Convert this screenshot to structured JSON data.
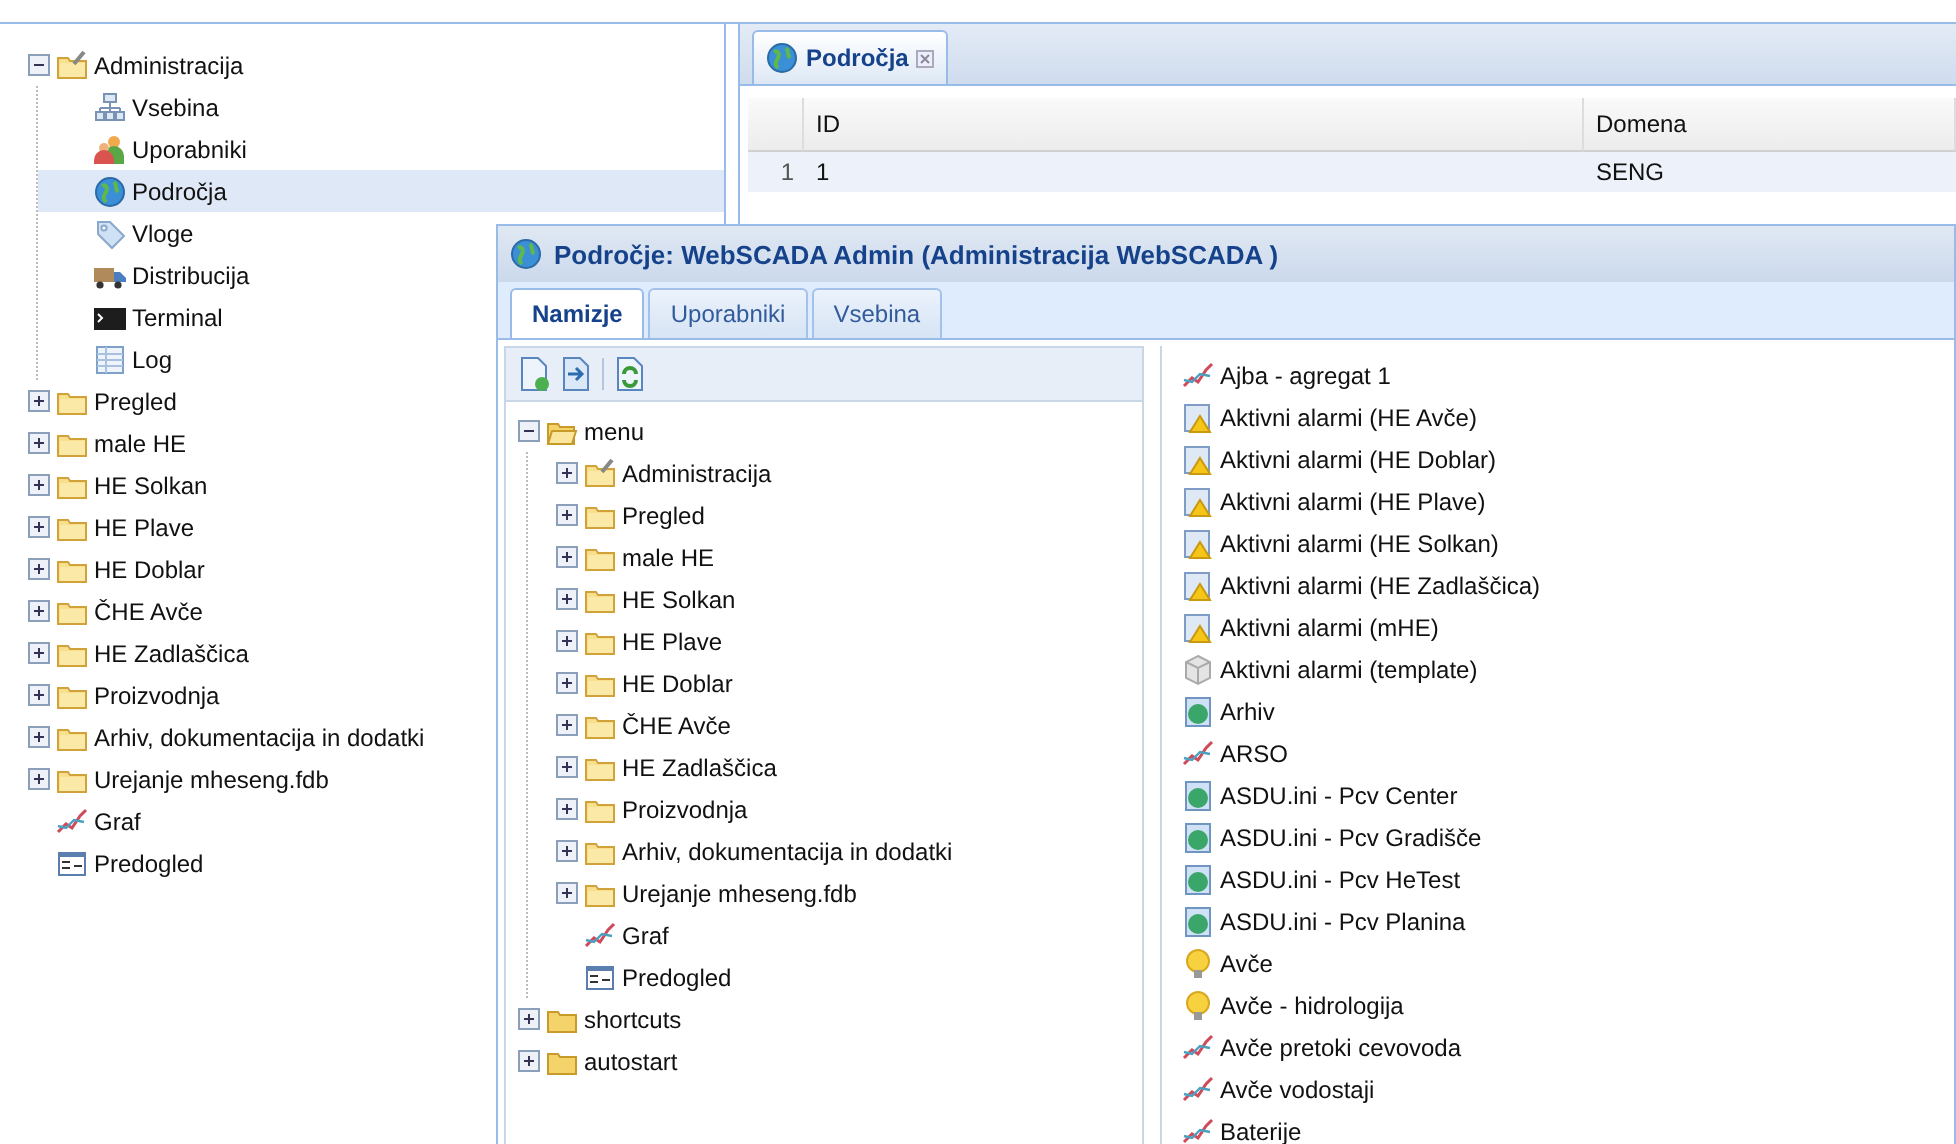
{
  "navigation_tree": {
    "items": [
      {
        "label": "Administracija",
        "kind": "admin",
        "expanded": true,
        "selected": false,
        "children": [
          {
            "label": "Vsebina",
            "kind": "content",
            "selected": false
          },
          {
            "label": "Uporabniki",
            "kind": "users",
            "selected": false
          },
          {
            "label": "Področja",
            "kind": "globe",
            "selected": true
          },
          {
            "label": "Vloge",
            "kind": "tag",
            "selected": false
          },
          {
            "label": "Distribucija",
            "kind": "truck",
            "selected": false
          },
          {
            "label": "Terminal",
            "kind": "terminal",
            "selected": false
          },
          {
            "label": "Log",
            "kind": "table",
            "selected": false
          }
        ]
      },
      {
        "label": "Pregled",
        "kind": "folder",
        "expanded": false,
        "selected": false
      },
      {
        "label": "male HE",
        "kind": "folder",
        "expanded": false,
        "selected": false
      },
      {
        "label": "HE Solkan",
        "kind": "folder",
        "expanded": false,
        "selected": false
      },
      {
        "label": "HE Plave",
        "kind": "folder",
        "expanded": false,
        "selected": false
      },
      {
        "label": "HE Doblar",
        "kind": "folder",
        "expanded": false,
        "selected": false
      },
      {
        "label": "ČHE Avče",
        "kind": "folder",
        "expanded": false,
        "selected": false
      },
      {
        "label": "HE Zadlaščica",
        "kind": "folder",
        "expanded": false,
        "selected": false
      },
      {
        "label": "Proizvodnja",
        "kind": "folder",
        "expanded": false,
        "selected": false
      },
      {
        "label": "Arhiv, dokumentacija in dodatki",
        "kind": "folder",
        "expanded": false,
        "selected": false
      },
      {
        "label": "Urejanje mheseng.fdb",
        "kind": "folder",
        "expanded": false,
        "selected": false
      },
      {
        "label": "Graf",
        "kind": "graph",
        "selected": false
      },
      {
        "label": "Predogled",
        "kind": "preview",
        "selected": false
      }
    ]
  },
  "main_panel": {
    "tab": {
      "label": "Področja",
      "kind": "globe"
    },
    "table": {
      "columns": [
        "ID",
        "Domena"
      ],
      "rows": [
        {
          "number": "1",
          "cells": [
            "1",
            "SENG"
          ]
        }
      ]
    }
  },
  "dialog": {
    "title": "Področje: WebSCADA Admin (Administracija WebSCADA )",
    "tabs": [
      {
        "label": "Namizje",
        "selected": true
      },
      {
        "label": "Uporabniki",
        "selected": false
      },
      {
        "label": "Vsebina",
        "selected": false
      }
    ],
    "toolbar": [
      {
        "kind": "add"
      },
      {
        "kind": "import"
      },
      {
        "kind": "refresh"
      }
    ],
    "menu_tree": {
      "items": [
        {
          "label": "menu",
          "kind": "open",
          "expanded": true,
          "children": [
            {
              "label": "Administracija",
              "kind": "admin",
              "expanded": false
            },
            {
              "label": "Pregled",
              "kind": "folder",
              "expanded": false
            },
            {
              "label": "male HE",
              "kind": "folder",
              "expanded": false
            },
            {
              "label": "HE Solkan",
              "kind": "folder",
              "expanded": false
            },
            {
              "label": "HE Plave",
              "kind": "folder",
              "expanded": false
            },
            {
              "label": "HE Doblar",
              "kind": "folder",
              "expanded": false
            },
            {
              "label": "ČHE Avče",
              "kind": "folder",
              "expanded": false
            },
            {
              "label": "HE Zadlaščica",
              "kind": "folder",
              "expanded": false
            },
            {
              "label": "Proizvodnja",
              "kind": "folder",
              "expanded": false
            },
            {
              "label": "Arhiv, dokumentacija in dodatki",
              "kind": "folder",
              "expanded": false
            },
            {
              "label": "Urejanje mheseng.fdb",
              "kind": "folder",
              "expanded": false
            },
            {
              "label": "Graf",
              "kind": "graph"
            },
            {
              "label": "Predogled",
              "kind": "preview"
            }
          ]
        },
        {
          "label": "shortcuts",
          "kind": "plain",
          "expanded": false
        },
        {
          "label": "autostart",
          "kind": "plain",
          "expanded": false
        }
      ]
    },
    "available_items": [
      {
        "label": "Ajba - agregat 1",
        "kind": "graph"
      },
      {
        "label": "Aktivni alarmi (HE Avče)",
        "kind": "alarm"
      },
      {
        "label": "Aktivni alarmi (HE Doblar)",
        "kind": "alarm"
      },
      {
        "label": "Aktivni alarmi (HE Plave)",
        "kind": "alarm"
      },
      {
        "label": "Aktivni alarmi (HE Solkan)",
        "kind": "alarm"
      },
      {
        "label": "Aktivni alarmi (HE Zadlaščica)",
        "kind": "alarm"
      },
      {
        "label": "Aktivni alarmi (mHE)",
        "kind": "alarm"
      },
      {
        "label": "Aktivni alarmi (template)",
        "kind": "cube"
      },
      {
        "label": "Arhiv",
        "kind": "page"
      },
      {
        "label": "ARSO",
        "kind": "graph"
      },
      {
        "label": "ASDU.ini - Pcv Center",
        "kind": "page"
      },
      {
        "label": "ASDU.ini - Pcv Gradišče",
        "kind": "page"
      },
      {
        "label": "ASDU.ini - Pcv HeTest",
        "kind": "page"
      },
      {
        "label": "ASDU.ini - Pcv Planina",
        "kind": "page"
      },
      {
        "label": "Avče",
        "kind": "bulb"
      },
      {
        "label": "Avče - hidrologija",
        "kind": "bulb"
      },
      {
        "label": "Avče pretoki cevovoda",
        "kind": "graph"
      },
      {
        "label": "Avče vodostaji",
        "kind": "graph"
      },
      {
        "label": "Baterije",
        "kind": "graph"
      }
    ]
  }
}
